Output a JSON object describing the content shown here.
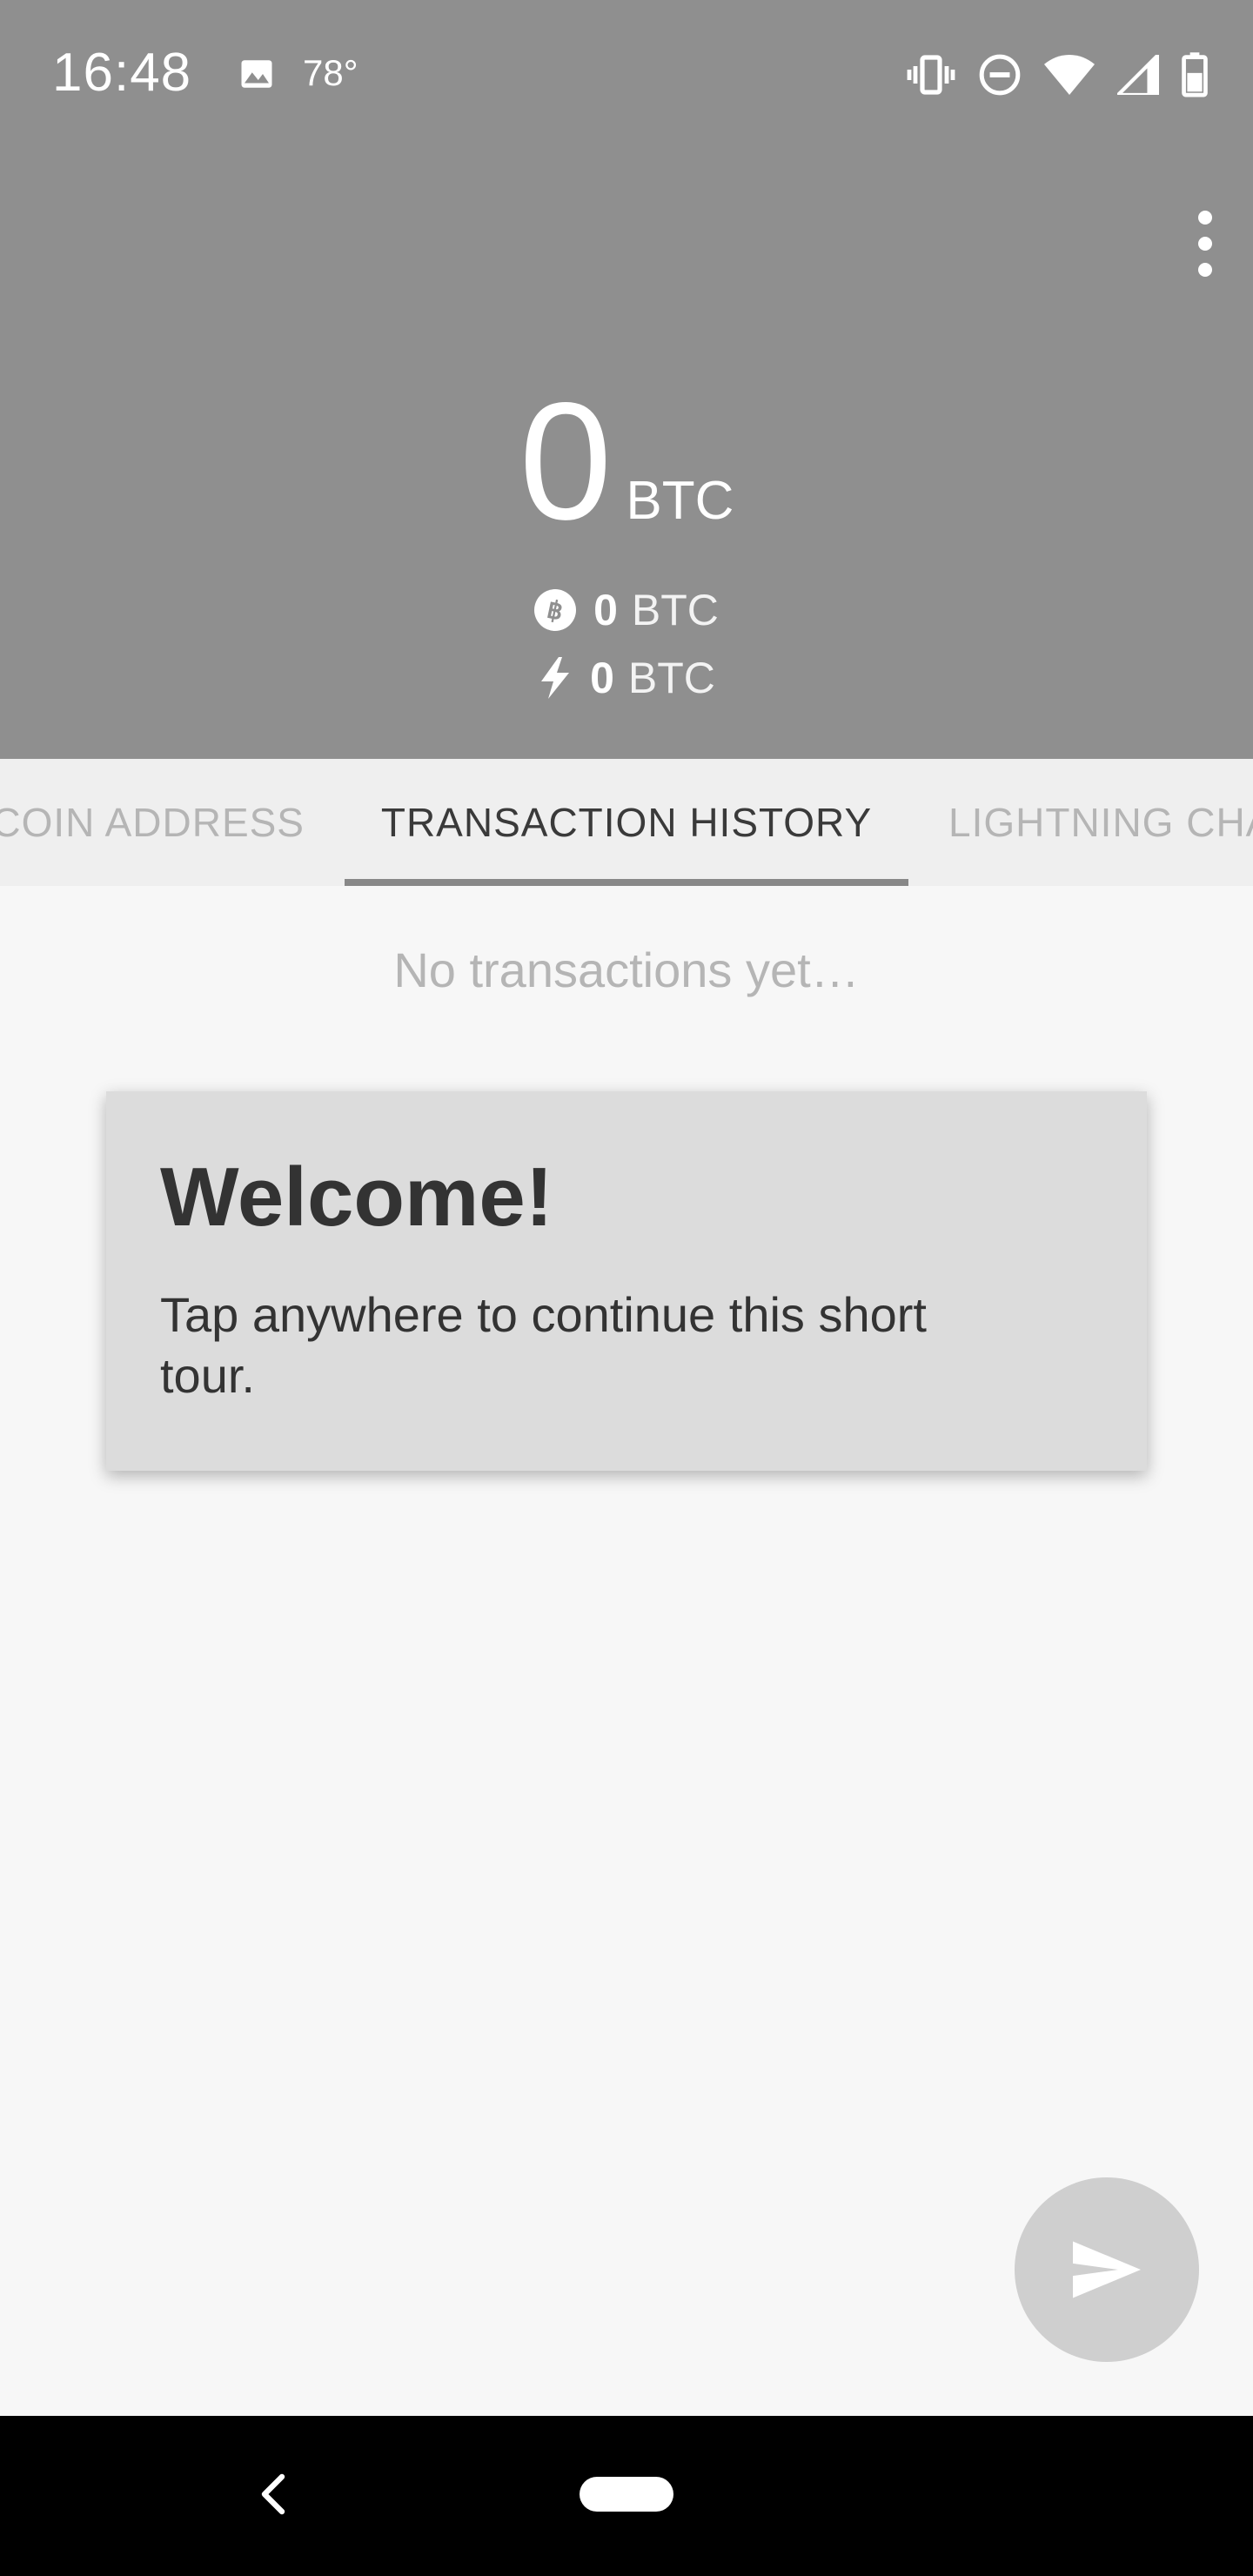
{
  "status_bar": {
    "time": "16:48",
    "temperature": "78°",
    "icons": [
      "image-icon",
      "vibrate-icon",
      "do-not-disturb-icon",
      "wifi-icon",
      "cell-signal-icon",
      "battery-icon"
    ]
  },
  "header": {
    "menu_icon": "more-vert-icon",
    "balance": {
      "amount": "0",
      "unit": "BTC"
    },
    "onchain": {
      "icon": "bitcoin-icon",
      "amount": "0",
      "unit": "BTC"
    },
    "lightning": {
      "icon": "lightning-icon",
      "amount": "0",
      "unit": "BTC"
    }
  },
  "tabs": {
    "items": [
      {
        "label": "BITCOIN ADDRESS",
        "visible_text": "TCOIN ADDRESS"
      },
      {
        "label": "TRANSACTION HISTORY",
        "visible_text": "TRANSACTION HISTORY"
      },
      {
        "label": "LIGHTNING CHANNELS",
        "visible_text": "LIGHTNING CHA"
      }
    ],
    "selected": "TRANSACTION HISTORY"
  },
  "content": {
    "empty_message": "No transactions yet…"
  },
  "tour_card": {
    "title": "Welcome!",
    "body": "Tap anywhere to continue this short tour."
  },
  "fab": {
    "icon": "send-icon"
  },
  "nav_bar": {
    "back_icon": "back-icon",
    "home_icon": "home-pill-icon"
  },
  "colors": {
    "header_bg": "#8f8f8f",
    "tabs_bg": "#efefef",
    "content_bg": "#f7f7f7",
    "card_bg": "#dcdcdc",
    "fab_bg": "#cfcfcf",
    "nav_bg": "#000000"
  }
}
